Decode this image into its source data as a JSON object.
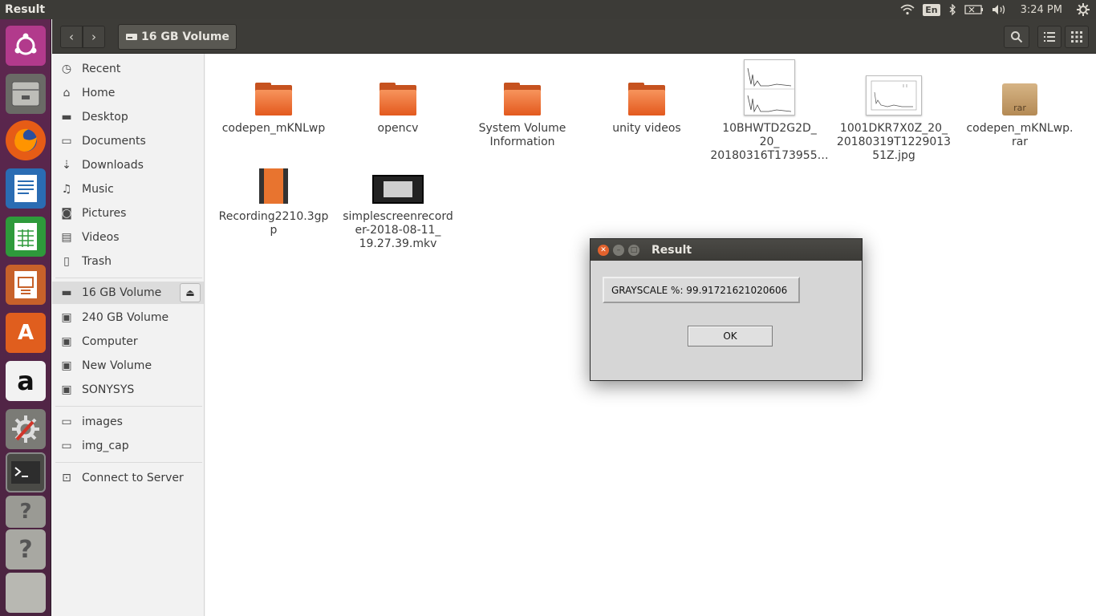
{
  "top_panel": {
    "app_title": "Result",
    "keyboard_layout": "En",
    "clock": "3:24 PM"
  },
  "launcher": {
    "items": [
      {
        "name": "ubuntu-dash-icon"
      },
      {
        "name": "files-icon"
      },
      {
        "name": "firefox-icon"
      },
      {
        "name": "libreoffice-writer-icon"
      },
      {
        "name": "libreoffice-calc-icon"
      },
      {
        "name": "libreoffice-impress-icon"
      },
      {
        "name": "software-center-icon"
      },
      {
        "name": "amazon-icon"
      },
      {
        "name": "system-settings-icon"
      },
      {
        "name": "terminal-icon"
      },
      {
        "name": "unknown-app-icon"
      },
      {
        "name": "unknown-app-icon"
      },
      {
        "name": "trash-drives-icon"
      }
    ]
  },
  "header": {
    "path_label": "16 GB Volume"
  },
  "sidebar": {
    "places": [
      {
        "label": "Recent",
        "icon": "clock-icon"
      },
      {
        "label": "Home",
        "icon": "home-icon"
      },
      {
        "label": "Desktop",
        "icon": "folder-icon"
      },
      {
        "label": "Documents",
        "icon": "document-icon"
      },
      {
        "label": "Downloads",
        "icon": "download-icon"
      },
      {
        "label": "Music",
        "icon": "music-icon"
      },
      {
        "label": "Pictures",
        "icon": "camera-icon"
      },
      {
        "label": "Videos",
        "icon": "film-icon"
      },
      {
        "label": "Trash",
        "icon": "trash-icon"
      }
    ],
    "devices": [
      {
        "label": "16 GB Volume",
        "icon": "drive-icon",
        "active": true
      },
      {
        "label": "240 GB Volume",
        "icon": "drive-icon"
      },
      {
        "label": "Computer",
        "icon": "drive-icon"
      },
      {
        "label": "New Volume",
        "icon": "drive-icon"
      },
      {
        "label": "SONYSYS",
        "icon": "drive-icon"
      }
    ],
    "bookmarks": [
      {
        "label": "images",
        "icon": "folder-icon"
      },
      {
        "label": "img_cap",
        "icon": "folder-icon"
      }
    ],
    "network": [
      {
        "label": "Connect to Server",
        "icon": "server-icon"
      }
    ]
  },
  "files": [
    {
      "name": "codepen_mKNLwp",
      "type": "folder"
    },
    {
      "name": "opencv",
      "type": "folder"
    },
    {
      "name": "System Volume\nInformation",
      "type": "folder"
    },
    {
      "name": "unity videos",
      "type": "folder"
    },
    {
      "name": "10BHWTD2G2D_\n20_\n20180316T173955…",
      "type": "image"
    },
    {
      "name": "1001DKR7X0Z_20_\n20180319T1229013\n51Z.jpg",
      "type": "image"
    },
    {
      "name": "codepen_mKNLwp.\nrar",
      "type": "archive"
    },
    {
      "name": "Recording2210.3gp\np",
      "type": "video"
    },
    {
      "name": "simplescreenrecord\ner-2018-08-11_\n19.27.39.mkv",
      "type": "video"
    }
  ],
  "dialog": {
    "title": "Result",
    "result_text": "GRAYSCALE %: 99.91721621020606",
    "ok_label": "OK"
  }
}
